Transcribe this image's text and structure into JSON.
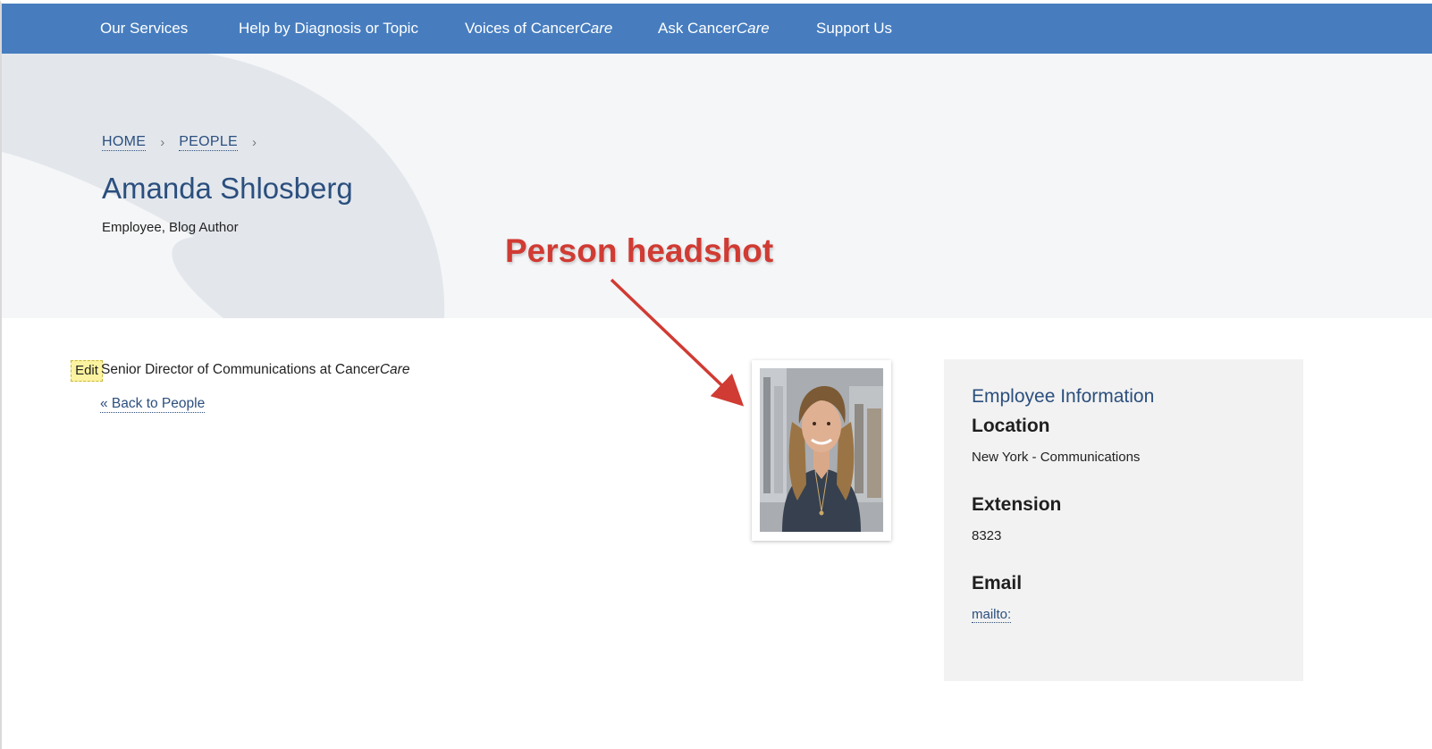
{
  "nav": {
    "items": [
      {
        "label": "Our Services",
        "italic_suffix": ""
      },
      {
        "label": "Help by Diagnosis or Topic",
        "italic_suffix": ""
      },
      {
        "label": "Voices of Cancer",
        "italic_suffix": "Care"
      },
      {
        "label": "Ask Cancer",
        "italic_suffix": "Care"
      },
      {
        "label": "Support Us",
        "italic_suffix": ""
      }
    ]
  },
  "breadcrumb": {
    "home": "HOME",
    "people": "PEOPLE",
    "separator": "›"
  },
  "person": {
    "name": "Amanda Shlosberg",
    "roles": "Employee, Blog Author",
    "title_prefix": "Senior Director of Communications at Cancer",
    "title_italic": "Care"
  },
  "edit_label": "Edit",
  "back_link": "« Back to People",
  "annotation": {
    "label": "Person headshot",
    "color": "#d03b33"
  },
  "employee_info": {
    "heading": "Employee Information",
    "location_label": "Location",
    "location_value": "New York - Communications",
    "extension_label": "Extension",
    "extension_value": "8323",
    "email_label": "Email",
    "email_value": "mailto:"
  },
  "colors": {
    "nav_bg": "#477dbf",
    "heading_blue": "#2b4f7e",
    "panel_bg": "#f2f2f2",
    "hero_bg": "#f5f6f8"
  }
}
